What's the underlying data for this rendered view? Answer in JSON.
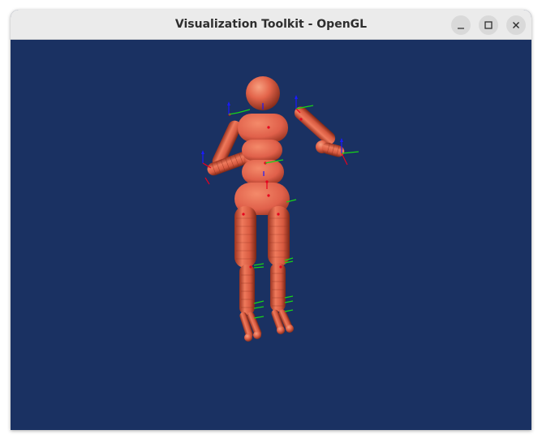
{
  "window": {
    "title": "Visualization Toolkit - OpenGL"
  },
  "colors": {
    "titlebar": "#ebebeb",
    "viewport_background": "#1a3162",
    "model": "#e3644a",
    "axis_x": "#e8001e",
    "axis_y": "#18d418",
    "axis_z": "#1a1aff"
  },
  "icons": {
    "minimize": "minimize-icon",
    "maximize": "maximize-icon",
    "close": "close-icon"
  }
}
